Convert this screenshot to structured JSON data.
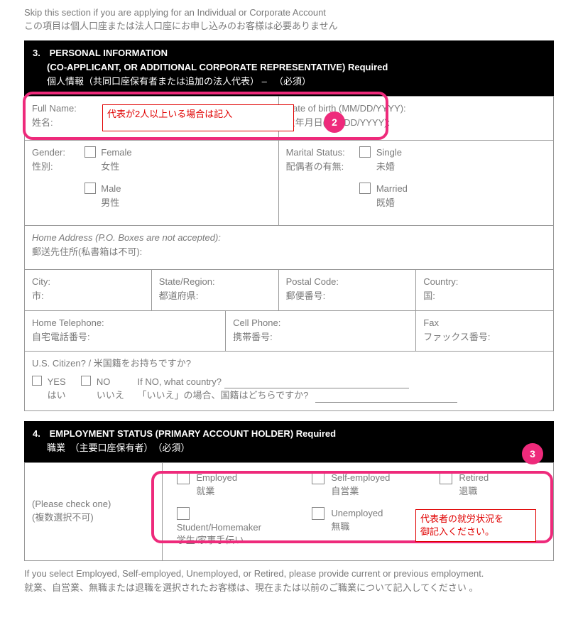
{
  "skip": {
    "en": "Skip this section if you are applying for an Individual or Corporate Account",
    "jp": "この項目は個人口座または法人口座にお申し込みのお客様は必要ありません"
  },
  "section3": {
    "num": "3.",
    "title_en1": "PERSONAL INFORMATION",
    "title_en2": "(CO-APPLICANT, OR ADDITIONAL CORPORATE REPRESENTATIVE)  Required",
    "title_jp": "個人情報（共同口座保有者または追加の法人代表） – 　（必須）"
  },
  "fields": {
    "fullname_en": "Full Name:",
    "fullname_jp": "姓名:",
    "dob_en": "Date of birth (MM/DD/YYYY):",
    "dob_jp": "生年月日(MM/DD/YYYY):",
    "gender_en": "Gender:",
    "gender_jp": "性別:",
    "female_en": "Female",
    "female_jp": "女性",
    "male_en": "Male",
    "male_jp": "男性",
    "marital_en": "Marital Status:",
    "marital_jp": "配偶者の有無:",
    "single_en": "Single",
    "single_jp": "未婚",
    "married_en": "Married",
    "married_jp": "既婚",
    "home_addr_en": "Home Address (P.O. Boxes are not accepted):",
    "home_addr_jp": "郵送先住所(私書箱は不可):",
    "city_en": "City:",
    "city_jp": "市:",
    "state_en": "State/Region:",
    "state_jp": "都道府県:",
    "postal_en": "Postal Code:",
    "postal_jp": "郵便番号:",
    "country_en": "Country:",
    "country_jp": "国:",
    "home_tel_en": "Home Telephone:",
    "home_tel_jp": "自宅電話番号:",
    "cell_en": "Cell Phone:",
    "cell_jp": "携帯番号:",
    "fax_en": "Fax",
    "fax_jp": "ファックス番号:",
    "citizen_q_en": "U.S. Citizen? / 米国籍をお持ちですか?",
    "yes_en": "YES",
    "yes_jp": "はい",
    "no_en": "NO",
    "no_jp": "いいえ",
    "ifno_en": "If NO, what country?",
    "ifno_jp": "「いいえ」の場合、国籍はどちらですか?"
  },
  "section4": {
    "num": "4.",
    "title_en": "EMPLOYMENT STATUS  (PRIMARY ACCOUNT HOLDER)  Required",
    "title_jp": "職業　（主要口座保有者）　（必須）"
  },
  "employment": {
    "check_one_en": "(Please check one)",
    "check_one_jp": "(複数選択不可)",
    "employed_en": "Employed",
    "employed_jp": "就業",
    "self_en": "Self-employed",
    "self_jp": "自営業",
    "retired_en": "Retired",
    "retired_jp": "退職",
    "student_en": "Student/Homemaker",
    "student_jp": "学生/家事手伝い",
    "unemployed_en": "Unemployed",
    "unemployed_jp": "無職"
  },
  "bottom_note": {
    "en": "If you select Employed, Self-employed, Unemployed, or Retired, please provide current or previous employment.",
    "jp": "就業、自営業、無職または退職を選択されたお客様は、現在または以前のご職業について記入してください 。"
  },
  "annotations": {
    "badge2": "2",
    "badge3": "3",
    "red1": "代表が2人以上いる場合は記入",
    "red2a": "代表者の就労状況を",
    "red2b": "御記入ください。"
  }
}
